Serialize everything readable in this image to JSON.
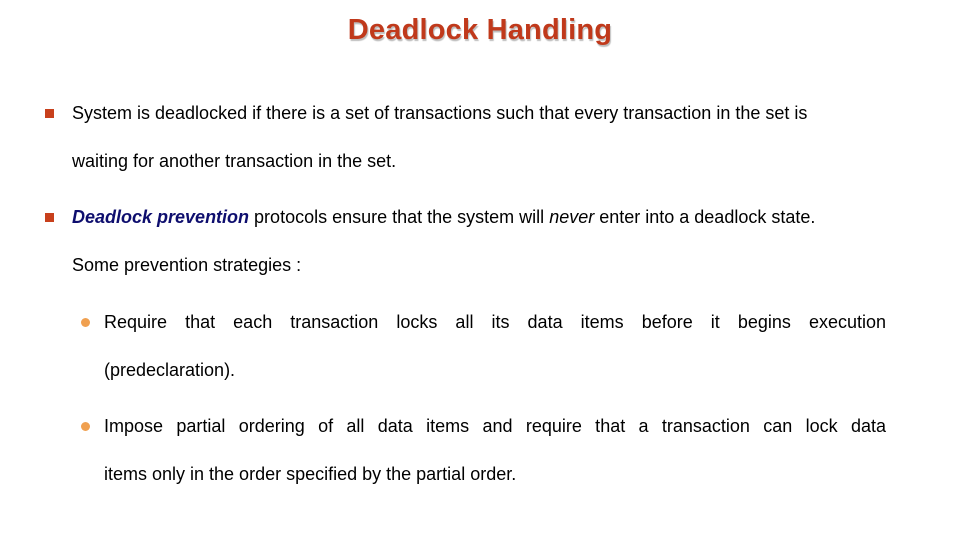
{
  "title": "Deadlock Handling",
  "bullets": [
    {
      "line1": "System is deadlocked if there is a set of transactions such that every transaction in the set is",
      "line2": "waiting for another transaction in the set."
    },
    {
      "em": "Deadlock prevention",
      "text_a": " protocols ensure that the system will ",
      "italic": "never",
      "text_b": " enter into a deadlock state.",
      "line2": "Some prevention strategies :"
    }
  ],
  "sub_bullets": [
    {
      "line1": "Require that each transaction locks all its data items before it begins execution",
      "line2": "(predeclaration)."
    },
    {
      "line1": "Impose partial ordering of all data items and require that a transaction can lock data",
      "line2": "items only in the order specified by the partial order."
    }
  ],
  "colors": {
    "title": "#c0391b",
    "square_bullet": "#c8401c",
    "round_bullet": "#f0a050",
    "emphasis": "#0e0e6e"
  }
}
